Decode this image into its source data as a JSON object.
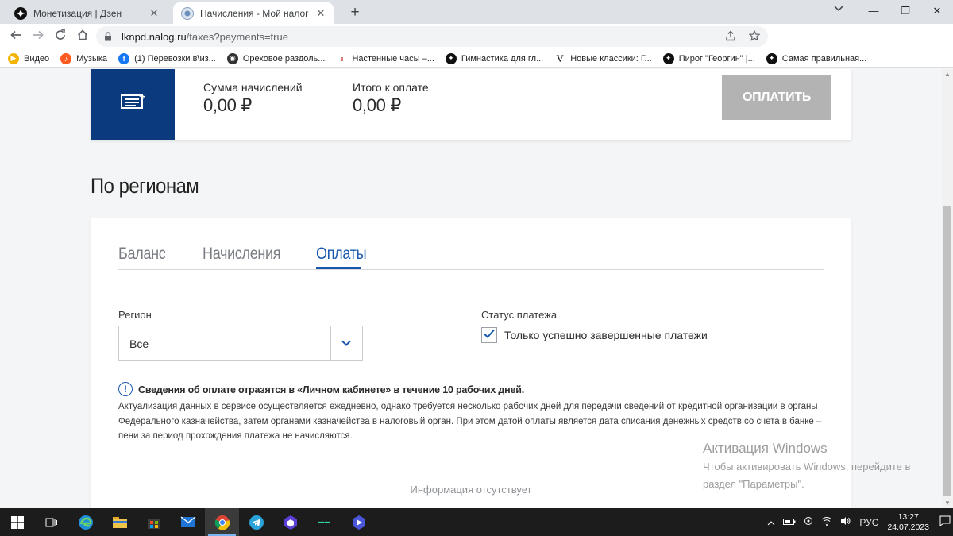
{
  "browser": {
    "tabs": [
      {
        "title": "Монетизация | Дзен",
        "icon": "dzen-icon",
        "active": false
      },
      {
        "title": "Начисления - Мой налог",
        "icon": "nalog-icon",
        "active": true
      }
    ],
    "new_tab": "+",
    "url_host": "lknpd.nalog.ru",
    "url_path": "/taxes?payments=true",
    "window_buttons": {
      "minimize": "—",
      "restore": "❐",
      "close": "✕"
    }
  },
  "bookmarks": [
    {
      "label": "Видео",
      "icon": "video-icon",
      "color": "#f2b400"
    },
    {
      "label": "Музыка",
      "icon": "music-icon",
      "color": "#ff5a1f"
    },
    {
      "label": "(1) Перевозки в\\из...",
      "icon": "facebook-icon",
      "color": "#1877f2"
    },
    {
      "label": "Ореховое раздоль...",
      "icon": "site-icon",
      "color": "#333333"
    },
    {
      "label": "Настенные часы –...",
      "icon": "clock-site-icon",
      "color": "#c0392b"
    },
    {
      "label": "Гимнастика для гл...",
      "icon": "dzen-icon",
      "color": "#111111"
    },
    {
      "label": "Новые классики: Г...",
      "icon": "v-icon",
      "color": "#111111"
    },
    {
      "label": "Пирог \"Георгин\" |...",
      "icon": "dzen-icon",
      "color": "#111111"
    },
    {
      "label": "Самая правильная...",
      "icon": "dzen-icon",
      "color": "#111111"
    }
  ],
  "summary": {
    "accrued_label": "Сумма начислений",
    "accrued_value": "0,00 ₽",
    "total_label": "Итого к оплате",
    "total_value": "0,00 ₽",
    "pay_button": "ОПЛАТИТЬ"
  },
  "regions": {
    "title": "По регионам",
    "tabs": [
      "Баланс",
      "Начисления",
      "Оплаты"
    ],
    "active_tab": "Оплаты",
    "region_label": "Регион",
    "region_value": "Все",
    "status_label": "Статус платежа",
    "status_checkbox_label": "Только успешно завершенные платежи",
    "status_checked": true,
    "info_title": "Сведения об оплате отразятся в «Личном кабинете» в течение 10 рабочих дней.",
    "info_text": "Актуализация данных в сервисе осуществляется ежедневно, однако требуется несколько рабочих дней для передачи сведений от кредитной организации в органы Федерального казначейства, затем органами казначейства в налоговый орган. При этом датой оплаты является дата списания денежных средств со счета в банке – пени за период прохождения платежа не начисляются.",
    "empty_text": "Информация отсутствует"
  },
  "watermark": {
    "line1": "Активация Windows",
    "line2": "Чтобы активировать Windows, перейдите в",
    "line3": "раздел \"Параметры\"."
  },
  "taskbar": {
    "lang": "РУС",
    "time": "13:27",
    "date": "24.07.2023"
  },
  "colors": {
    "brand_blue": "#0b3a7e",
    "accent_blue": "#1a58b0",
    "pay_disabled": "#b3b3b3"
  }
}
